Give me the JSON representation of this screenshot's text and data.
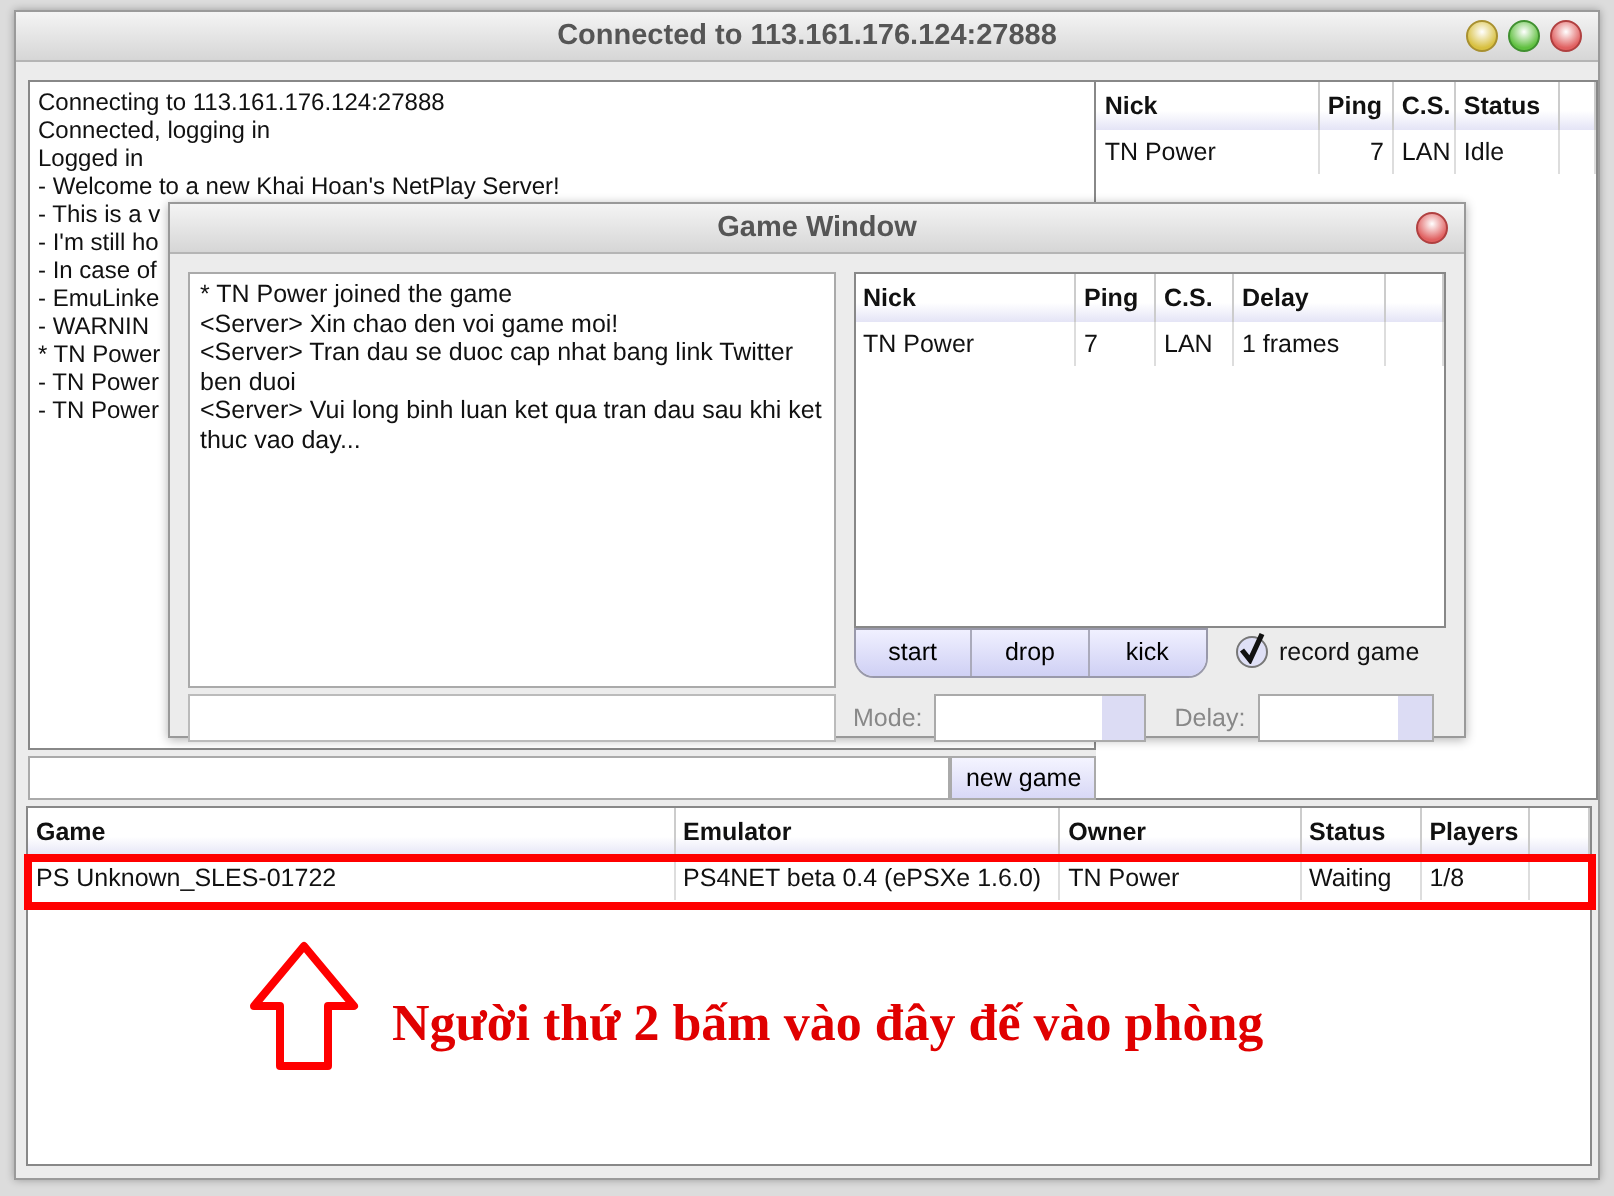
{
  "window": {
    "title": "Connected to 113.161.176.124:27888"
  },
  "server_log": [
    "Connecting to 113.161.176.124:27888",
    "Connected, logging in",
    "Logged in",
    "- Welcome to a new Khai Hoan's NetPlay Server!",
    "- This is a v",
    "- I'm still ho",
    "- In case of",
    "- EmuLinke",
    "- WARNIN",
    "* TN Power",
    "- TN Power",
    "- TN Power"
  ],
  "new_game_button": "new game",
  "users_table": {
    "columns": [
      "Nick",
      "Ping",
      "C.S.",
      "Status"
    ],
    "rows": [
      [
        "TN Power",
        "7",
        "LAN",
        "Idle"
      ]
    ]
  },
  "game_window": {
    "title": "Game Window",
    "chat": [
      "* TN Power joined the game",
      "<Server> Xin chao den voi game moi!",
      "<Server> Tran dau se duoc cap nhat bang link Twitter ben duoi",
      "<Server> Vui long binh luan ket qua tran dau sau khi ket thuc vao day..."
    ],
    "players_table": {
      "columns": [
        "Nick",
        "Ping",
        "C.S.",
        "Delay"
      ],
      "rows": [
        [
          "TN Power",
          "7",
          "LAN",
          "1 frames"
        ]
      ]
    },
    "buttons": [
      "start",
      "drop",
      "kick"
    ],
    "record_game": {
      "label": "record game",
      "checked": true
    },
    "mode": {
      "label": "Mode:"
    },
    "delay": {
      "label": "Delay:"
    }
  },
  "games_table": {
    "columns": [
      "Game",
      "Emulator",
      "Owner",
      "Status",
      "Players"
    ],
    "rows": [
      [
        "PS Unknown_SLES-01722",
        "PS4NET beta 0.4 (ePSXe 1.6.0)",
        "TN Power",
        "Waiting",
        "1/8"
      ]
    ]
  },
  "annotation": {
    "text": "Người thứ 2 bấm vào đây đế vào phòng"
  }
}
